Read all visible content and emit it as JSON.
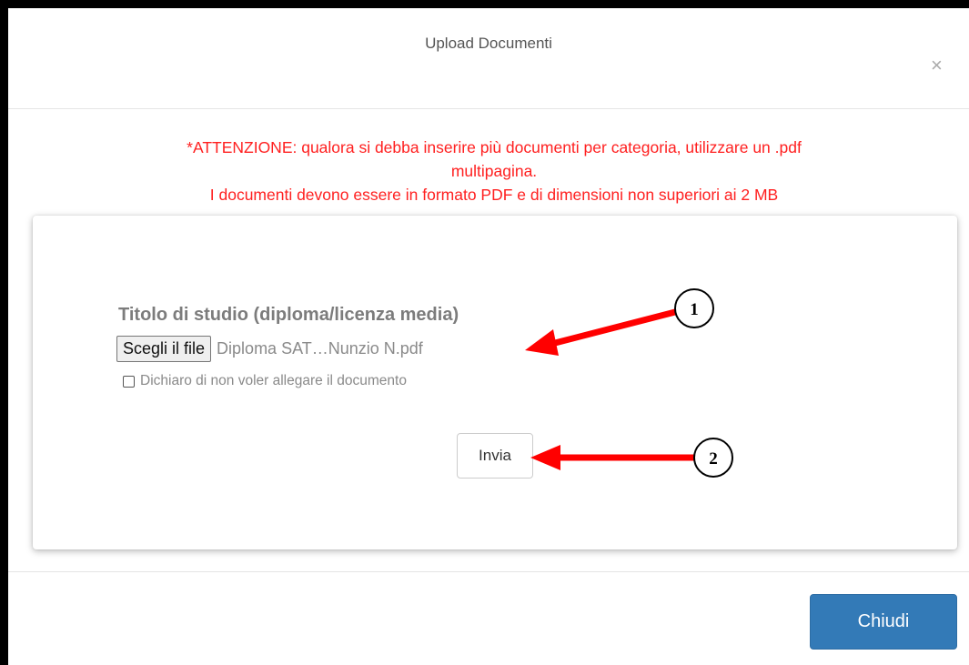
{
  "modal": {
    "title": "Upload Documenti",
    "close_glyph": "×"
  },
  "warning": {
    "line1": "*ATTENZIONE: qualora si debba inserire più documenti per categoria, utilizzare un .pdf",
    "line2": "multipagina.",
    "line3": "I documenti devono essere in formato PDF e di dimensioni non superiori ai 2 MB",
    "color": "#ff2020"
  },
  "form": {
    "field_label": "Titolo di studio (diploma/licenza media)",
    "file_button_label": "Scegli il file",
    "file_name": "Diploma SAT…Nunzio N.pdf",
    "declaration_label": "Dichiaro di non voler allegare il documento",
    "submit_label": "Invia"
  },
  "footer": {
    "close_label": "Chiudi",
    "accent": "#337ab7"
  },
  "annotations": {
    "arrow_color": "#ff0000",
    "callouts": [
      {
        "number": "1"
      },
      {
        "number": "2"
      }
    ]
  }
}
